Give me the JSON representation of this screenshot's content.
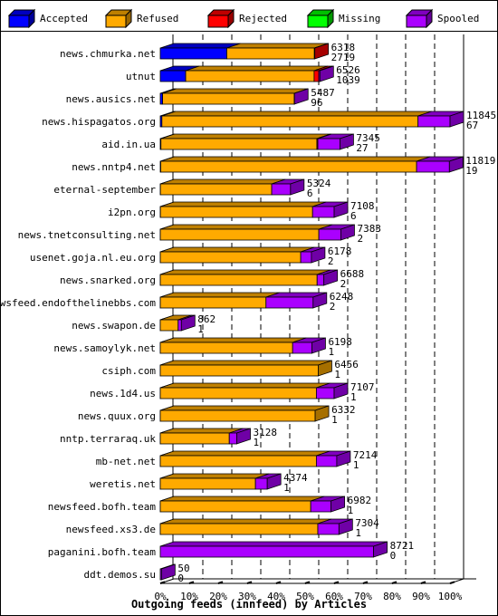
{
  "chart_data": {
    "type": "bar",
    "orientation": "horizontal",
    "stacked": true,
    "style": "3d",
    "title": "Outgoing feeds (innfeed) by Articles",
    "xlim": [
      0,
      100
    ],
    "xunit": "%",
    "x_ticks": [
      "0%",
      "10%",
      "20%",
      "30%",
      "40%",
      "50%",
      "60%",
      "70%",
      "80%",
      "90%",
      "100%"
    ],
    "grid": true,
    "legend_position": "top",
    "categories": [
      "news.chmurka.net",
      "utnut",
      "news.ausics.net",
      "news.hispagatos.org",
      "aid.in.ua",
      "news.nntp4.net",
      "eternal-september",
      "i2pn.org",
      "news.tnetconsulting.net",
      "usenet.goja.nl.eu.org",
      "news.snarked.org",
      "newsfeed.endofthelinebbs.com",
      "news.swapon.de",
      "news.samoylyk.net",
      "csiph.com",
      "news.1d4.us",
      "news.quux.org",
      "nntp.terraraq.uk",
      "mb-net.net",
      "weretis.net",
      "newsfeed.bofh.team",
      "newsfeed.xs3.de",
      "paganini.bofh.team",
      "ddt.demos.su"
    ],
    "series": [
      {
        "name": "Accepted",
        "color": "#0000ff",
        "values": [
          2719,
          1039,
          96,
          67,
          27,
          19,
          6,
          6,
          2,
          2,
          2,
          2,
          1,
          1,
          1,
          1,
          1,
          1,
          1,
          1,
          1,
          1,
          0,
          0
        ]
      },
      {
        "name": "Refused",
        "color": "#ffaa00",
        "values": [
          3581,
          5250,
          5380,
          10470,
          6375,
          10460,
          4550,
          6220,
          6480,
          5740,
          6410,
          4320,
          730,
          5410,
          6455,
          6380,
          6331,
          2820,
          6380,
          3890,
          6150,
          6440,
          0,
          0
        ]
      },
      {
        "name": "Rejected",
        "color": "#ff0000",
        "values": [
          18,
          190,
          0,
          0,
          40,
          0,
          0,
          0,
          0,
          0,
          0,
          0,
          0,
          0,
          0,
          0,
          0,
          0,
          0,
          0,
          0,
          0,
          0,
          0
        ]
      },
      {
        "name": "Missing",
        "color": "#00ff00",
        "values": [
          0,
          0,
          0,
          0,
          0,
          0,
          0,
          0,
          0,
          0,
          0,
          0,
          0,
          0,
          0,
          0,
          0,
          0,
          0,
          0,
          0,
          0,
          0,
          0
        ]
      },
      {
        "name": "Spooled",
        "color": "#aa00ff",
        "values": [
          0,
          47,
          11,
          1308,
          903,
          1340,
          768,
          882,
          901,
          436,
          276,
          1926,
          131,
          787,
          0,
          726,
          0,
          307,
          833,
          483,
          831,
          863,
          8721,
          50
        ]
      }
    ],
    "bar_labels": [
      [
        "6318",
        "2719"
      ],
      [
        "6526",
        "1039"
      ],
      [
        "5487",
        "96"
      ],
      [
        "11845",
        "67"
      ],
      [
        "7345",
        "27"
      ],
      [
        "11819",
        "19"
      ],
      [
        "5324",
        "6"
      ],
      [
        "7108",
        "6"
      ],
      [
        "7383",
        "2"
      ],
      [
        "6178",
        "2"
      ],
      [
        "6688",
        "2"
      ],
      [
        "6248",
        "2"
      ],
      [
        "862",
        "1"
      ],
      [
        "6198",
        "1"
      ],
      [
        "6456",
        "1"
      ],
      [
        "7107",
        "1"
      ],
      [
        "6332",
        "1"
      ],
      [
        "3128",
        "1"
      ],
      [
        "7214",
        "1"
      ],
      [
        "4374",
        "1"
      ],
      [
        "6982",
        "1"
      ],
      [
        "7304",
        "1"
      ],
      [
        "8721",
        "0"
      ],
      [
        "50",
        "0"
      ]
    ],
    "max_total": 11845
  }
}
